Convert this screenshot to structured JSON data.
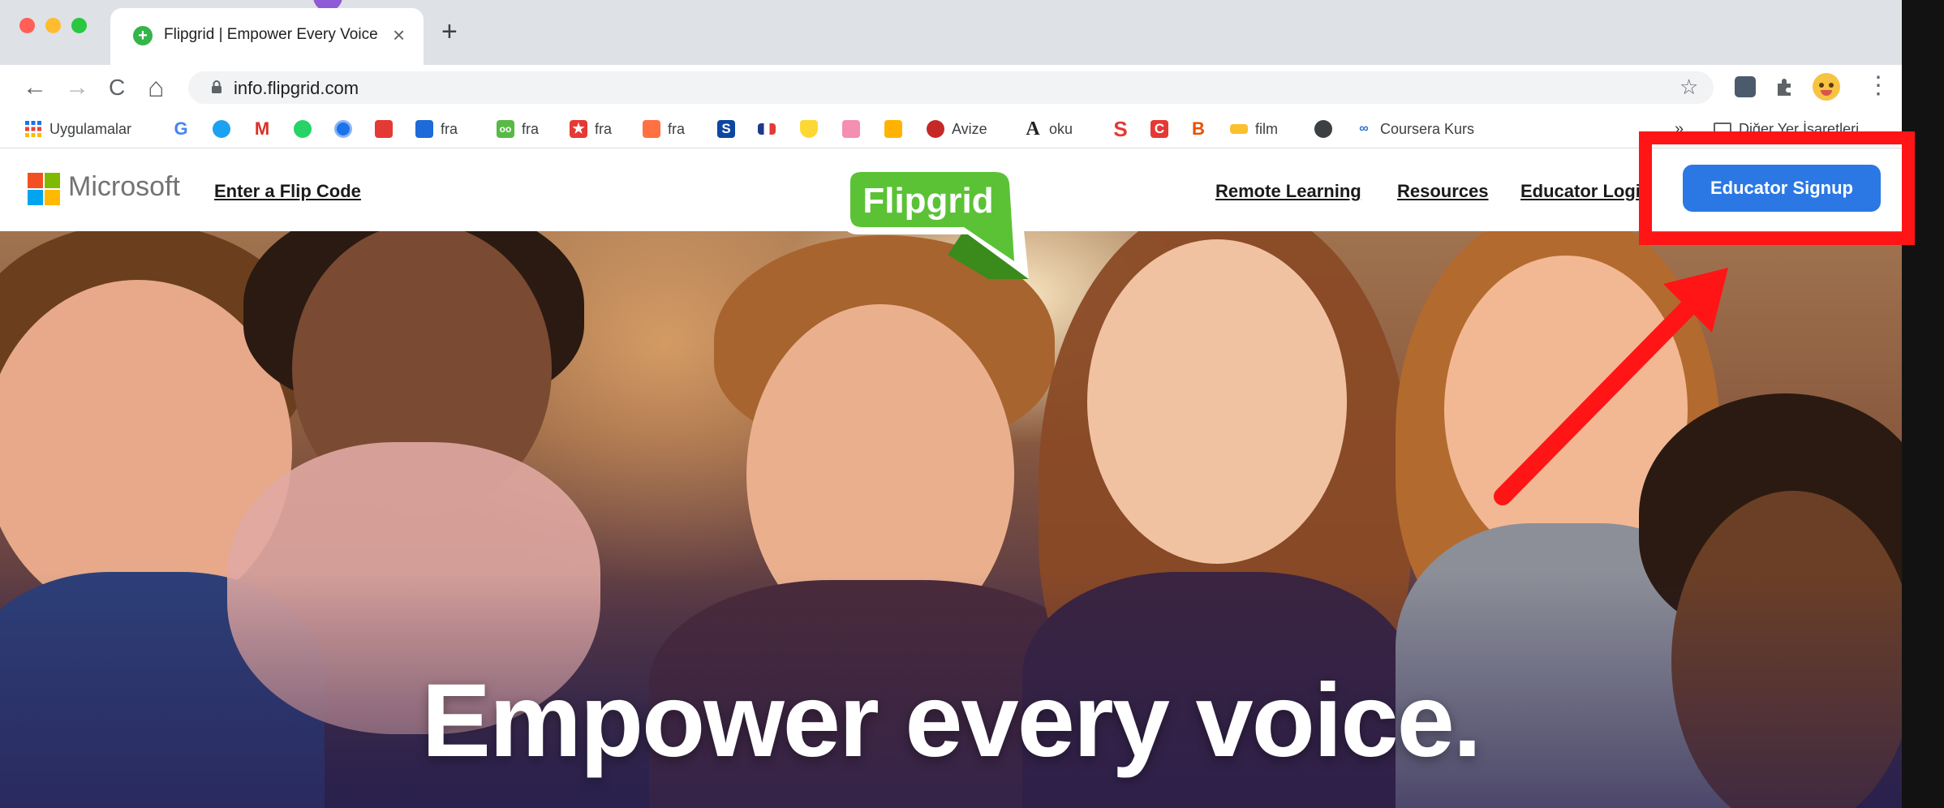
{
  "browser": {
    "tab": {
      "title": "Flipgrid | Empower Every Voice",
      "close": "×"
    },
    "new_tab": "+",
    "url": "info.flipgrid.com",
    "nav": {
      "back": "←",
      "forward": "→",
      "reload": "C",
      "home": "⌂"
    },
    "menu": "⋮",
    "star": "☆",
    "bookmarks": [
      {
        "label": "Uygulamalar",
        "icon": "apps-grid-icon"
      },
      {
        "label": "",
        "icon": "google-icon"
      },
      {
        "label": "",
        "icon": "twitter-icon"
      },
      {
        "label": "",
        "icon": "gmail-icon"
      },
      {
        "label": "",
        "icon": "whatsapp-icon"
      },
      {
        "label": "",
        "icon": "circle-icon"
      },
      {
        "label": "",
        "icon": "red-tile-icon"
      },
      {
        "label": "fra",
        "icon": "blue-person-icon"
      },
      {
        "label": "fra",
        "icon": "green-oo-icon"
      },
      {
        "label": "fra",
        "icon": "red-star-icon"
      },
      {
        "label": "fra",
        "icon": "orange-tile-icon"
      },
      {
        "label": "",
        "icon": "blue-s-icon"
      },
      {
        "label": "",
        "icon": "french-flag-icon"
      },
      {
        "label": "",
        "icon": "shield-icon"
      },
      {
        "label": "",
        "icon": "pink-tile-icon"
      },
      {
        "label": "",
        "icon": "yellow-tile-icon"
      },
      {
        "label": "Avize",
        "icon": "ladybug-icon"
      },
      {
        "label": "oku",
        "icon": "letter-a-icon"
      },
      {
        "label": "",
        "icon": "red-s-icon"
      },
      {
        "label": "",
        "icon": "red-c-icon"
      },
      {
        "label": "",
        "icon": "b-icon"
      },
      {
        "label": "film",
        "icon": "yellow-bar-icon"
      },
      {
        "label": "",
        "icon": "globe-icon"
      },
      {
        "label": "Coursera Kurs",
        "icon": "coursera-icon"
      }
    ],
    "bookmarks_overflow": "»",
    "other_bookmarks": "Diğer Yer İşaretleri"
  },
  "site": {
    "microsoft": "Microsoft",
    "enter_code": "Enter a Flip Code",
    "logo": "Flipgrid",
    "nav": [
      "Remote Learning",
      "Resources",
      "Educator Logi"
    ],
    "signup": "Educator Signup",
    "headline": "Empower every voice."
  },
  "colors": {
    "accent_button": "#2b78e4",
    "flipgrid_green": "#5bc236",
    "annotation_red": "#ff1515"
  }
}
